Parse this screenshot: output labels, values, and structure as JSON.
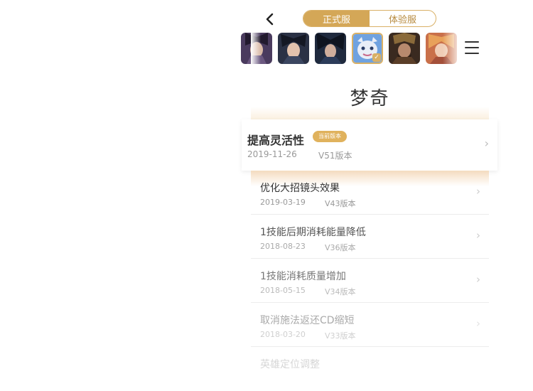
{
  "nav": {
    "back_icon": "chevron-left-icon",
    "tabs": [
      {
        "label": "正式服",
        "active": true
      },
      {
        "label": "体验服",
        "active": false
      }
    ],
    "menu_icon": "hamburger-menu-icon",
    "accent_color": "#d4a757"
  },
  "heroes": [
    {
      "name": "hero-1",
      "selected": false
    },
    {
      "name": "hero-2",
      "selected": false
    },
    {
      "name": "hero-3",
      "selected": false
    },
    {
      "name": "hero-mengqi",
      "selected": true
    },
    {
      "name": "hero-5",
      "selected": false
    },
    {
      "name": "hero-6",
      "selected": false
    }
  ],
  "hero_name": "梦奇",
  "current_version": {
    "title": "提高灵活性",
    "badge": "当前版本",
    "date": "2019-11-26",
    "version": "V51版本"
  },
  "history": [
    {
      "title": "优化大招镜头效果",
      "date": "2019-03-19",
      "version": "V43版本"
    },
    {
      "title": "1技能后期消耗能量降低",
      "date": "2018-08-23",
      "version": "V36版本"
    },
    {
      "title": "1技能消耗质量增加",
      "date": "2018-05-15",
      "version": "V34版本"
    },
    {
      "title": "取消施法返还CD缩短",
      "date": "2018-03-20",
      "version": "V33版本"
    },
    {
      "title": "英雄定位调整",
      "date": "",
      "version": ""
    }
  ]
}
